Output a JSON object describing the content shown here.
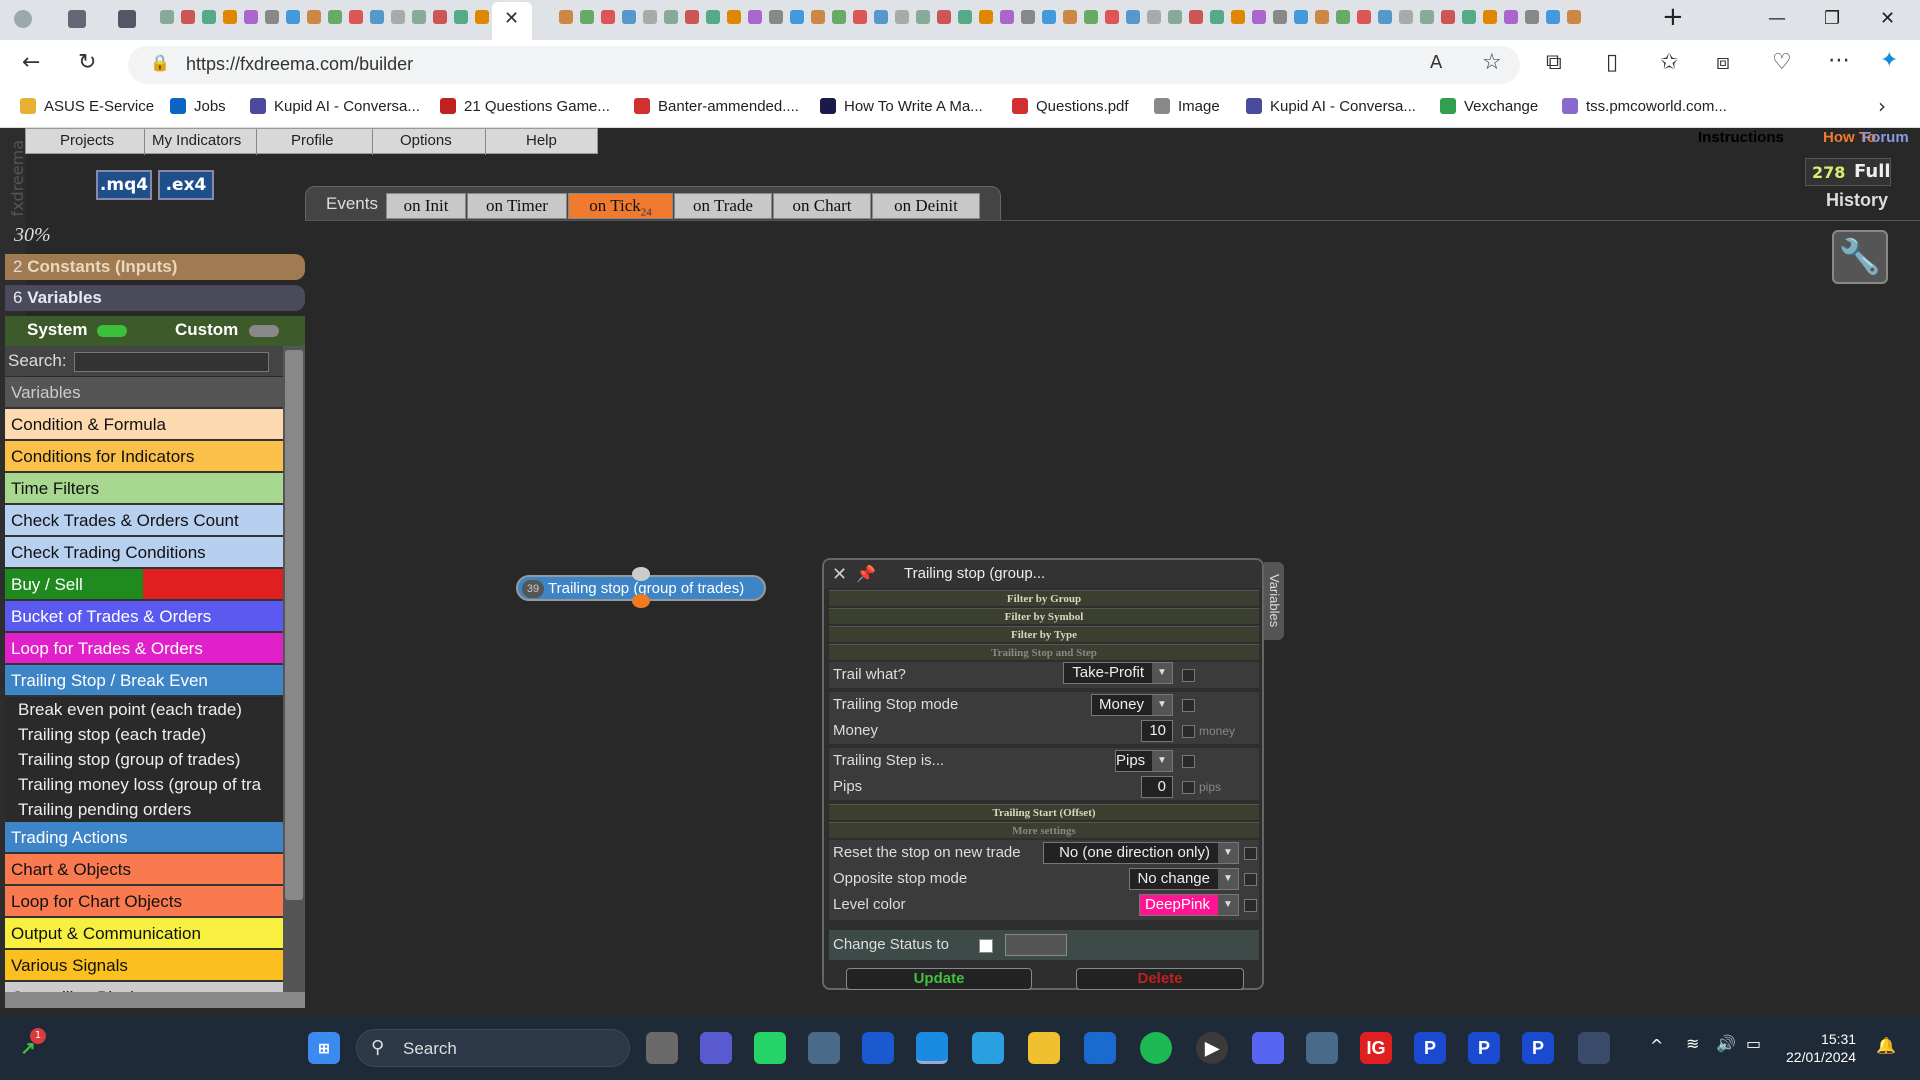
{
  "browser": {
    "url": "https://fxdreema.com/builder",
    "bookmarks": [
      {
        "label": "ASUS E-Service",
        "color": "#e8b030"
      },
      {
        "label": "Jobs",
        "color": "#0a66c2"
      },
      {
        "label": "Kupid AI - Conversa...",
        "color": "#4a4aa0"
      },
      {
        "label": "21 Questions Game...",
        "color": "#c02020"
      },
      {
        "label": "Banter-ammended....",
        "color": "#d03030"
      },
      {
        "label": "How To Write A Ma...",
        "color": "#1a1a4a"
      },
      {
        "label": "Questions.pdf",
        "color": "#d03030"
      },
      {
        "label": "Image",
        "color": "#888888"
      },
      {
        "label": "Kupid AI - Conversa...",
        "color": "#4a4aa0"
      },
      {
        "label": "Vexchange",
        "color": "#30a050"
      },
      {
        "label": "tss.pmcoworld.com...",
        "color": "#8a6acd"
      }
    ]
  },
  "app": {
    "menu": [
      "Projects",
      "My Indicators",
      "Profile",
      "Options",
      "Help"
    ],
    "logo": "fxdreema",
    "file_buttons": [
      ".mq4",
      ".ex4"
    ],
    "top_links": [
      {
        "label": "Instructions",
        "color": "#c8e020"
      },
      {
        "label": "How To",
        "color": "#f07a30"
      },
      {
        "label": "Forum",
        "color": "#8a9ae0"
      }
    ],
    "counter": "278",
    "full_label": "Full",
    "history_label": "History",
    "events_label": "Events",
    "event_tabs": [
      {
        "label": "on Init",
        "badge": ""
      },
      {
        "label": "on Timer",
        "badge": ""
      },
      {
        "label": "on Tick",
        "badge": "24"
      },
      {
        "label": "on Trade",
        "badge": ""
      },
      {
        "label": "on Chart",
        "badge": ""
      },
      {
        "label": "on Deinit",
        "badge": ""
      }
    ],
    "active_tab": "on Tick",
    "zoom": "30%",
    "constants": {
      "count": "2",
      "label": "Constants (Inputs)"
    },
    "variables": {
      "count": "6",
      "label": "Variables"
    },
    "system_label": "System",
    "custom_label": "Custom",
    "search_label": "Search:",
    "categories": [
      {
        "label": "Variables",
        "bg": "#555555",
        "fg": "#cccccc"
      },
      {
        "label": "Condition & Formula",
        "bg": "#fdd9b0",
        "fg": "#111111"
      },
      {
        "label": "Conditions for Indicators",
        "bg": "#fbc04a",
        "fg": "#111111"
      },
      {
        "label": "Time Filters",
        "bg": "#a8d890",
        "fg": "#111111"
      },
      {
        "label": "Check Trades & Orders Count",
        "bg": "#b8d0f0",
        "fg": "#111111"
      },
      {
        "label": "Check Trading Conditions",
        "bg": "#b8d0f0",
        "fg": "#111111"
      },
      {
        "label": "Buy / Sell",
        "bg": "#1f8a1f",
        "fg": "#ffffff"
      },
      {
        "label": "Bucket of Trades & Orders",
        "bg": "#5a5af0",
        "fg": "#ffffff"
      },
      {
        "label": "Loop for Trades & Orders",
        "bg": "#e020c8",
        "fg": "#ffffff"
      },
      {
        "label": "Trailing Stop / Break Even",
        "bg": "#3d85c6",
        "fg": "#ffffff"
      }
    ],
    "subitems": [
      "Break even point (each trade)",
      "Trailing stop (each trade)",
      "Trailing stop (group of trades)",
      "Trailing money loss (group of tra",
      "Trailing pending orders"
    ],
    "categories2": [
      {
        "label": "Trading Actions",
        "bg": "#3d85c6",
        "fg": "#ffffff"
      },
      {
        "label": "Chart & Objects",
        "bg": "#fa7a50",
        "fg": "#111111"
      },
      {
        "label": "Loop for Chart Objects",
        "bg": "#fa7a50",
        "fg": "#111111"
      },
      {
        "label": "Output & Communication",
        "bg": "#f8f040",
        "fg": "#111111"
      },
      {
        "label": "Various Signals",
        "bg": "#fbc020",
        "fg": "#111111"
      },
      {
        "label": "Controlling Blocks",
        "bg": "#cccccc",
        "fg": "#111111"
      }
    ],
    "node": {
      "id": "39",
      "label": "Trailing stop (group of trades)"
    },
    "dialog": {
      "title": "Trailing stop (group...",
      "side_tab": "Variables",
      "sections": [
        "Filter by Group",
        "Filter by Symbol",
        "Filter by Type",
        "Trailing Stop and Step"
      ],
      "trail_what": {
        "label": "Trail what?",
        "value": "Take-Profit"
      },
      "ts_mode": {
        "label": "Trailing Stop mode",
        "value": "Money"
      },
      "money": {
        "label": "Money",
        "value": "10",
        "unit": "money"
      },
      "step_is": {
        "label": "Trailing Step is...",
        "value": "Pips"
      },
      "pips": {
        "label": "Pips",
        "value": "0",
        "unit": "pips"
      },
      "trailing_start": "Trailing Start (Offset)",
      "more_settings": "More settings",
      "reset_stop": {
        "label": "Reset the stop on new trade",
        "value": "No (one direction only)"
      },
      "opposite": {
        "label": "Opposite stop mode",
        "value": "No change"
      },
      "level_color": {
        "label": "Level color",
        "value": "DeepPink",
        "color": "#ff1493"
      },
      "status_label": "Change Status to",
      "update": "Update",
      "delete": "Delete"
    }
  },
  "taskbar": {
    "search": "Search",
    "time": "15:31",
    "date": "22/01/2024"
  }
}
